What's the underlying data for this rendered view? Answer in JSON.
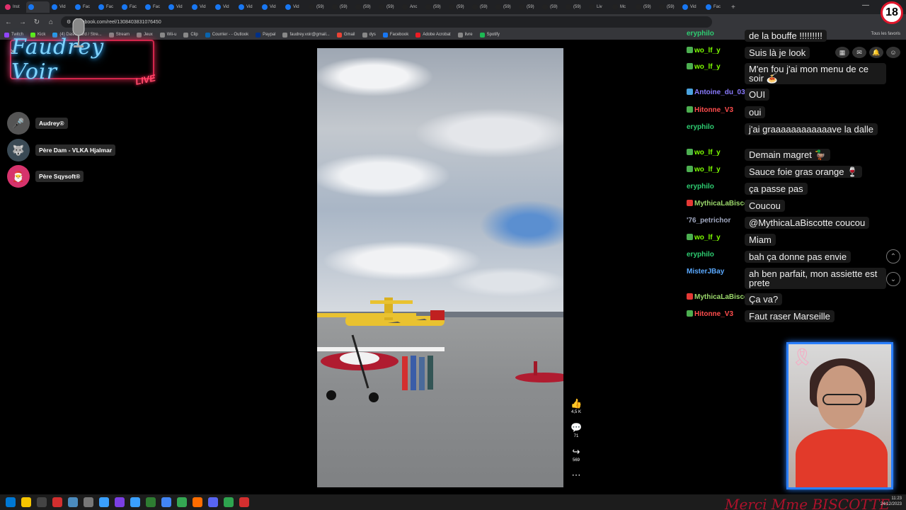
{
  "browser": {
    "tabs": [
      "Inst",
      "",
      "Vid",
      "Fac",
      "Fac",
      "Fac",
      "Fac",
      "Vid",
      "Vid",
      "Vid",
      "Vid",
      "Vid",
      "Vid",
      "(59)",
      "(59)",
      "(59)",
      "(59)",
      "Anc",
      "(59)",
      "(59)",
      "(59)",
      "(59)",
      "(59)",
      "(59)",
      "(59)",
      "Liv",
      "Mc",
      "(59)",
      "(59)",
      "Vid",
      "Fac"
    ],
    "tab_colors": [
      "#e1306c",
      "#1877f2",
      "#1877f2",
      "#1877f2",
      "#1877f2",
      "#1877f2",
      "#1877f2",
      "#1877f2",
      "#1877f2",
      "#1877f2",
      "#1877f2",
      "#1877f2",
      "#1877f2",
      "#222",
      "#222",
      "#222",
      "#222",
      "#222",
      "#222",
      "#222",
      "#222",
      "#222",
      "#222",
      "#222",
      "#222",
      "#222",
      "#222",
      "#222",
      "#222",
      "#1877f2",
      "#1877f2"
    ],
    "url": "facebook.com/reel/1308403831076450",
    "bookmarks": [
      {
        "label": "Twitch",
        "color": "#9146ff"
      },
      {
        "label": "Kick",
        "color": "#53fc18"
      },
      {
        "label": "(4) Dashboard / Stre...",
        "color": "#1da1f2"
      },
      {
        "label": "Stream",
        "color": "#888"
      },
      {
        "label": "Jeux",
        "color": "#888"
      },
      {
        "label": "Wii-u",
        "color": "#888"
      },
      {
        "label": "Clip",
        "color": "#888"
      },
      {
        "label": "Courrier - - Outlook",
        "color": "#0a64ad"
      },
      {
        "label": "Paypal",
        "color": "#003087"
      },
      {
        "label": "faudrey.voir@gmail...",
        "color": "#888"
      },
      {
        "label": "Gmail",
        "color": "#ea4335"
      },
      {
        "label": "dys",
        "color": "#888"
      },
      {
        "label": "Facebook",
        "color": "#1877f2"
      },
      {
        "label": "Adobe Acrobat",
        "color": "#ec1c24"
      },
      {
        "label": "livre",
        "color": "#888"
      },
      {
        "label": "Spotify",
        "color": "#1db954"
      }
    ],
    "all_favorites": "Tous les favoris"
  },
  "overlay": {
    "logo_text": "Faudrey Voir",
    "live_text": "LIVE",
    "age_badge": "18"
  },
  "viewers": [
    {
      "name": "Audrey®",
      "emoji": "🎤",
      "color": "#555"
    },
    {
      "name": "Père Dam - VLKA Hjalmar",
      "emoji": "🐺",
      "color": "#3a4a55"
    },
    {
      "name": "Père Sqysoft®",
      "emoji": "🎅",
      "color": "#d6336c"
    }
  ],
  "video": {
    "reactions": [
      {
        "icon": "👍",
        "count": "4,5 K",
        "name": "like"
      },
      {
        "icon": "💬",
        "count": "71",
        "name": "comment"
      },
      {
        "icon": "↪",
        "count": "569",
        "name": "share"
      },
      {
        "icon": "⋯",
        "count": "",
        "name": "more"
      }
    ]
  },
  "chat": [
    {
      "user": "eryphilo",
      "color": "#2ecc71",
      "badge": "",
      "msg": "de la bouffe !!!!!!!!!"
    },
    {
      "user": "wo_lf_y",
      "color": "#7CFC00",
      "badge": "#4caf50",
      "msg": "Suis là je look"
    },
    {
      "user": "wo_lf_y",
      "color": "#7CFC00",
      "badge": "#4caf50",
      "msg": "M'en fou j'ai mon menu de ce soir 🍝"
    },
    {
      "user": "Antoine_du_03",
      "color": "#8a7bff",
      "badge": "#4aa3df",
      "msg": "OUI"
    },
    {
      "user": "Hitonne_V3",
      "color": "#ff4d4d",
      "badge": "#4caf50",
      "msg": "oui"
    },
    {
      "user": "eryphilo",
      "color": "#2ecc71",
      "badge": "",
      "msg": "j'ai graaaaaaaaaaaave la dalle"
    },
    {
      "user": "wo_lf_y",
      "color": "#7CFC00",
      "badge": "#4caf50",
      "msg": "Demain magret 🦆"
    },
    {
      "user": "wo_lf_y",
      "color": "#7CFC00",
      "badge": "#4caf50",
      "msg": "Sauce foie gras orange 🍷"
    },
    {
      "user": "eryphilo",
      "color": "#2ecc71",
      "badge": "",
      "msg": "ça passe pas"
    },
    {
      "user": "MythicaLaBiscotte",
      "color": "#9bd86b",
      "badge": "#e53935",
      "msg": "Coucou"
    },
    {
      "user": "'76_petrichor",
      "color": "#a0a8c0",
      "badge": "",
      "msg": "@MythicaLaBiscotte coucou"
    },
    {
      "user": "wo_lf_y",
      "color": "#7CFC00",
      "badge": "#4caf50",
      "msg": "Miam"
    },
    {
      "user": "eryphilo",
      "color": "#2ecc71",
      "badge": "",
      "msg": "bah ça donne pas envie"
    },
    {
      "user": "MisterJBay",
      "color": "#5aa9ff",
      "badge": "",
      "msg": "ah ben parfait, mon assiette est prete"
    },
    {
      "user": "MythicaLaBiscotte",
      "color": "#9bd86b",
      "badge": "#e53935",
      "msg": "Ça va?"
    },
    {
      "user": "Hitonne_V3",
      "color": "#ff4d4d",
      "badge": "#4caf50",
      "msg": "Faut raser Marseille"
    }
  ],
  "marquee": "Merci Mme BISCOTTE",
  "clock": {
    "time": "11:23",
    "date": "24/12/2023"
  },
  "taskbar_colors": [
    "#0078d4",
    "#f5c400",
    "#444",
    "#d32f2f",
    "#4b8bbe",
    "#777",
    "#3aa0ff",
    "#7b3fe4",
    "#3aa0ff",
    "#2e7d32",
    "#4285f4",
    "#34a853",
    "#ff6d00",
    "#5865f2",
    "#2ea44f",
    "#d32f2f"
  ]
}
